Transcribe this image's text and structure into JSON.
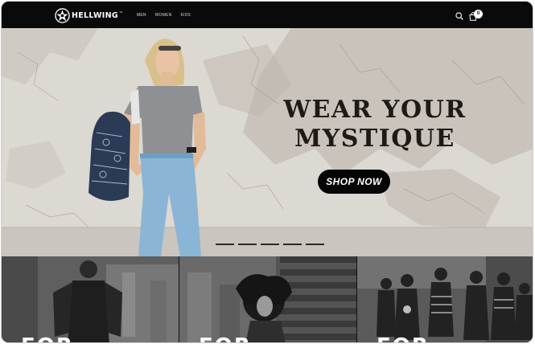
{
  "header": {
    "brand": "HELLWING",
    "nav": [
      {
        "label": "MEN"
      },
      {
        "label": "WOMEN"
      },
      {
        "label": "KIDS"
      }
    ],
    "cart_count": "0",
    "icons": [
      "star-logo-icon",
      "search-icon",
      "shopping-bag-icon"
    ]
  },
  "hero": {
    "headline_line1": "WEAR YOUR",
    "headline_line2": "MYSTIQUE",
    "cta_label": "SHOP NOW",
    "slides": 5,
    "active_slide": 1
  },
  "categories": [
    {
      "title": "FOR"
    },
    {
      "title": "FOR"
    },
    {
      "title": "FOR"
    }
  ],
  "colors": {
    "header_bg": "#0a0a0a",
    "cta_bg": "#050505",
    "headline": "#1e1a14"
  }
}
